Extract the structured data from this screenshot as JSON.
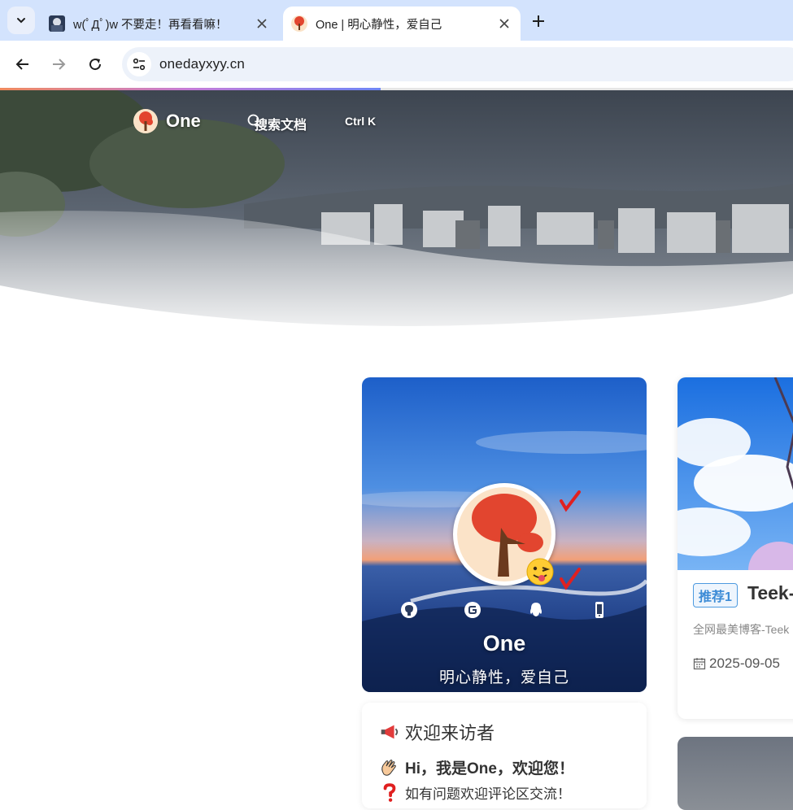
{
  "browser": {
    "tabs": [
      {
        "title": "w(ﾟДﾟ)w 不要走！再看看嘛！",
        "active": false
      },
      {
        "title": "One | 明心静性，爱自己",
        "active": true
      }
    ],
    "url": "onedayxyy.cn",
    "load_progress": 0.48
  },
  "site": {
    "brand": "One",
    "search_label": "搜索文档",
    "search_shortcut": "Ctrl K"
  },
  "profile": {
    "name": "One",
    "motto": "明心静性，爱自己",
    "social_icons": [
      "github-icon",
      "gitee-icon",
      "qq-icon",
      "phone-icon"
    ]
  },
  "welcome": {
    "title": "欢迎来访者",
    "greeting": "Hi，我是One，欢迎您！",
    "note": "如有问题欢迎评论区交流！"
  },
  "post": {
    "tag": "推荐1",
    "title": "Teek-",
    "description": "全网最美博客-Teek",
    "date": "2025-09-05"
  }
}
